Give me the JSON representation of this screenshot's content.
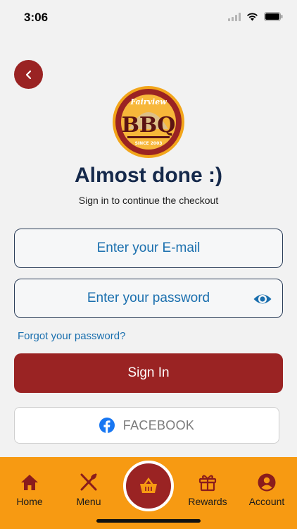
{
  "status_bar": {
    "time": "3:06"
  },
  "logo": {
    "top_text": "Fairview",
    "main_text": "BBQ",
    "since_text": "SINCE 2003"
  },
  "header": {
    "title": "Almost done :)",
    "subtitle": "Sign in to continue the checkout"
  },
  "form": {
    "email_placeholder": "Enter your E-mail",
    "email_value": "",
    "password_placeholder": "Enter your password",
    "password_value": "",
    "forgot_label": "Forgot your password?",
    "signin_label": "Sign In",
    "facebook_label": "FACEBOOK"
  },
  "tabs": [
    {
      "label": "Home",
      "icon": "home-icon"
    },
    {
      "label": "Menu",
      "icon": "utensils-icon"
    },
    {
      "label": "Rewards",
      "icon": "gift-icon"
    },
    {
      "label": "Account",
      "icon": "account-icon"
    }
  ],
  "colors": {
    "primary": "#9a2323",
    "accent": "#f79a12",
    "title": "#15294b",
    "link": "#1a6fae"
  }
}
